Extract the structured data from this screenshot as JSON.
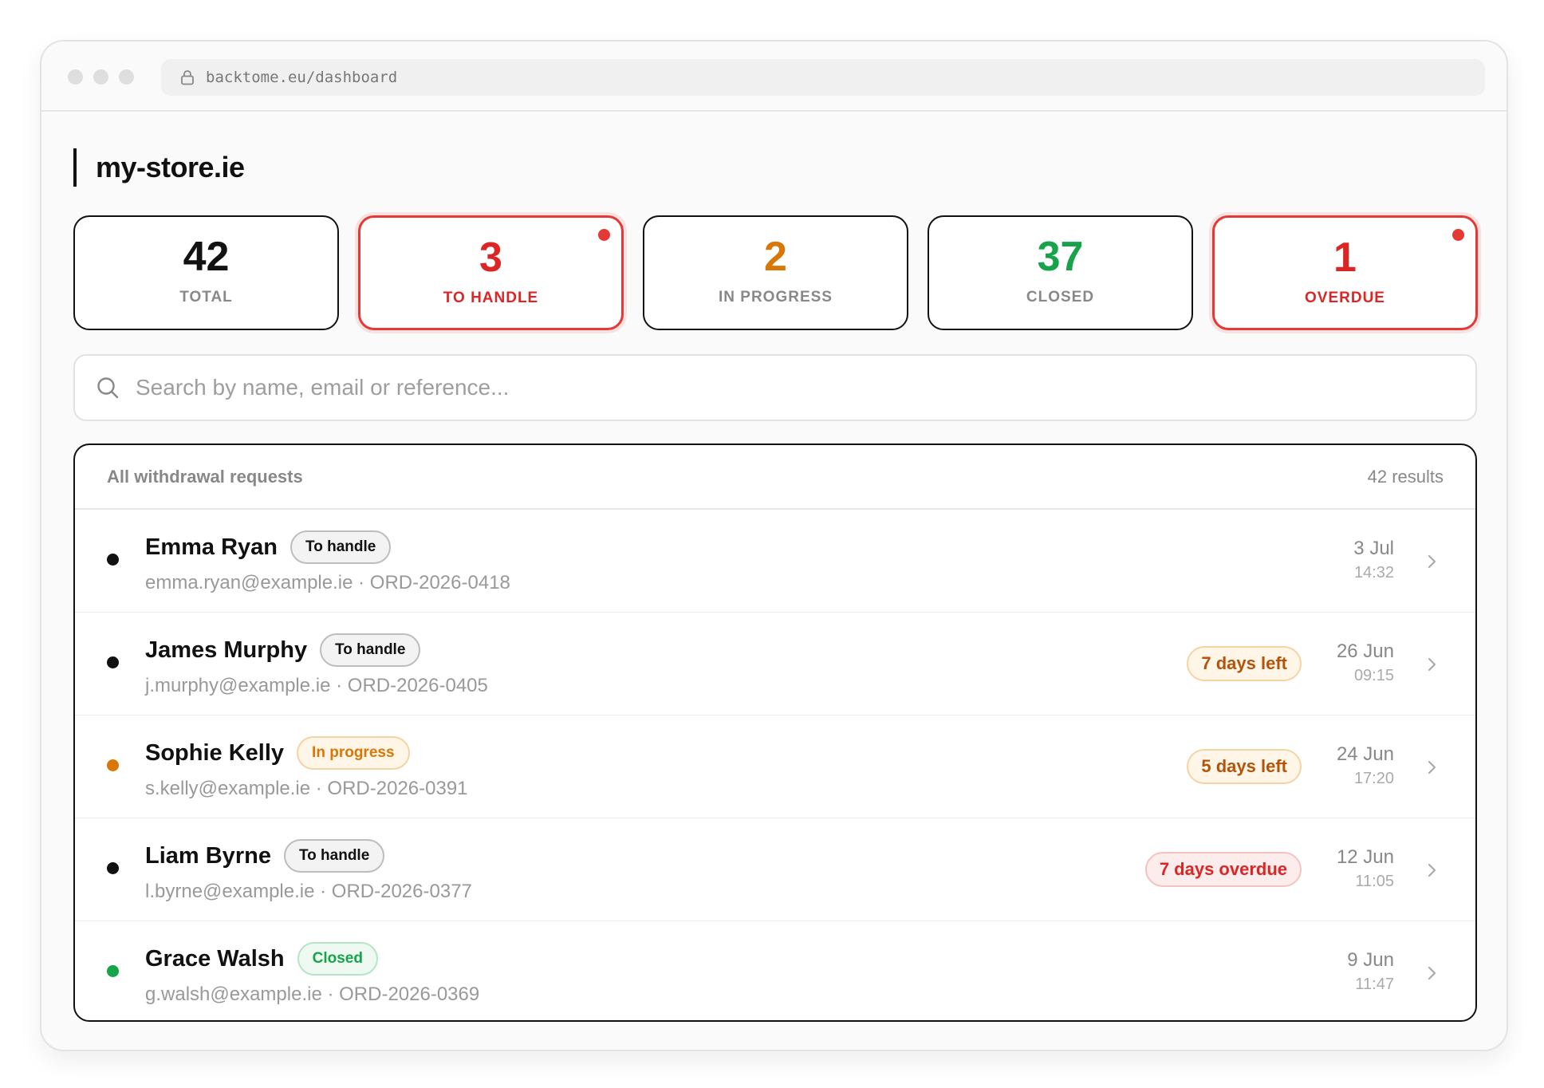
{
  "browser": {
    "url": "backtome.eu/dashboard"
  },
  "store": {
    "title": "my-store.ie"
  },
  "stats": [
    {
      "value": "42",
      "label": "TOTAL",
      "color": "#111111"
    },
    {
      "value": "3",
      "label": "TO HANDLE",
      "color": "#dc2626"
    },
    {
      "value": "2",
      "label": "IN PROGRESS",
      "color": "#d97706"
    },
    {
      "value": "37",
      "label": "CLOSED",
      "color": "#16a34a"
    },
    {
      "value": "1",
      "label": "OVERDUE",
      "color": "#dc2626"
    }
  ],
  "search": {
    "placeholder": "Search by name, email or reference..."
  },
  "list": {
    "title": "All withdrawal requests",
    "count": "42 results",
    "rows": [
      {
        "name": "Emma Ryan",
        "status": "To handle",
        "email": "emma.ryan@example.ie",
        "ref": "ORD-2026-0418",
        "sub": "emma.ryan@example.ie · ORD-2026-0418",
        "deadline": "",
        "date": "3 Jul",
        "time": "14:32",
        "dot_color": "#111111"
      },
      {
        "name": "James Murphy",
        "status": "To handle",
        "email": "j.murphy@example.ie",
        "ref": "ORD-2026-0405",
        "sub": "j.murphy@example.ie · ORD-2026-0405",
        "deadline": "7 days left",
        "date": "26 Jun",
        "time": "09:15",
        "dot_color": "#111111"
      },
      {
        "name": "Sophie Kelly",
        "status": "In progress",
        "email": "s.kelly@example.ie",
        "ref": "ORD-2026-0391",
        "sub": "s.kelly@example.ie · ORD-2026-0391",
        "deadline": "5 days left",
        "date": "24 Jun",
        "time": "17:20",
        "dot_color": "#d97706"
      },
      {
        "name": "Liam Byrne",
        "status": "To handle",
        "email": "l.byrne@example.ie",
        "ref": "ORD-2026-0377",
        "sub": "l.byrne@example.ie · ORD-2026-0377",
        "deadline": "7 days overdue",
        "date": "12 Jun",
        "time": "11:05",
        "dot_color": "#111111"
      },
      {
        "name": "Grace Walsh",
        "status": "Closed",
        "email": "g.walsh@example.ie",
        "ref": "ORD-2026-0369",
        "sub": "g.walsh@example.ie · ORD-2026-0369",
        "deadline": "",
        "date": "9 Jun",
        "time": "11:47",
        "dot_color": "#16a34a"
      }
    ]
  }
}
